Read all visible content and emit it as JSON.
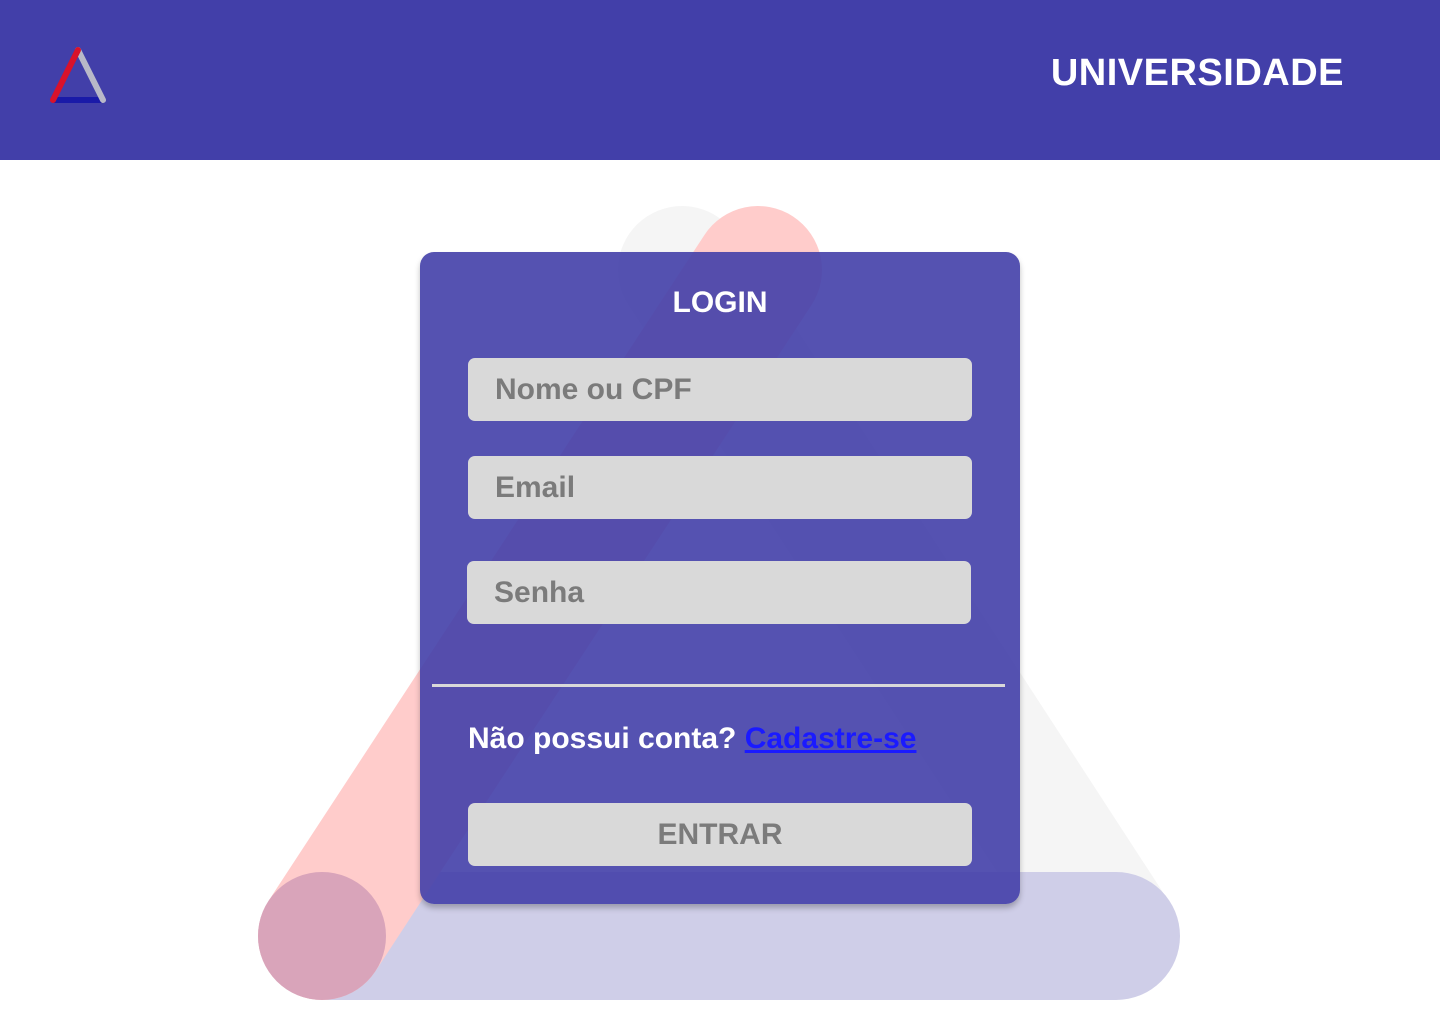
{
  "header": {
    "brand": "UNIVERSIDADE",
    "background_color": "#423fa9"
  },
  "logo": {
    "icon": "triangle-logo-icon",
    "colors": [
      "#d9122a",
      "#1a1aa8",
      "#b9b9c8"
    ]
  },
  "login": {
    "title": "LOGIN",
    "name_placeholder": "Nome ou CPF",
    "email_placeholder": "Email",
    "password_placeholder": "Senha",
    "signup_prompt": "Não possui conta?",
    "signup_link": "Cadastre-se",
    "submit_label": "ENTRAR",
    "card_color": "#423fa9",
    "link_color": "#1a1aff",
    "field_color": "#d9d9d9"
  }
}
